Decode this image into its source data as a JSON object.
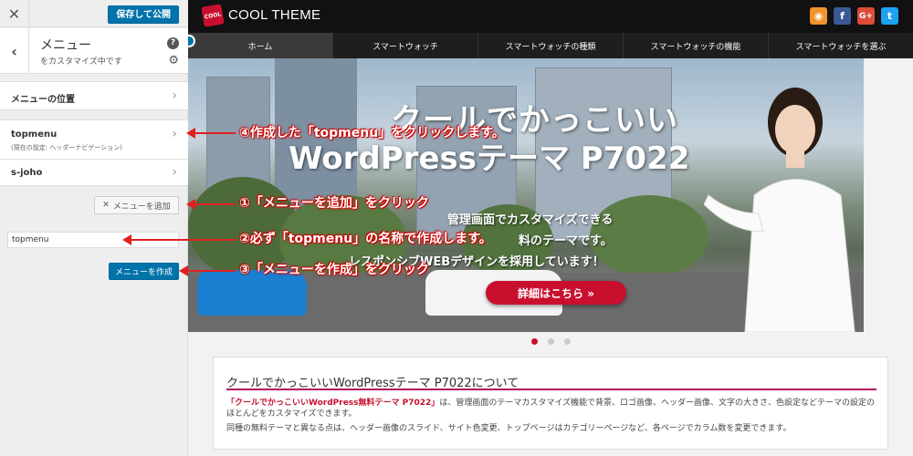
{
  "panel": {
    "close_icon": "close-icon",
    "save_label": "保存して公開",
    "title": "メニュー",
    "subtitle": "をカスタマイズ中です",
    "help_label": "?",
    "rows": [
      {
        "label": "メニューの位置",
        "sub": ""
      },
      {
        "label": "topmenu",
        "sub": "(現在の設定: ヘッダーナビゲーション)"
      },
      {
        "label": "s-joho",
        "sub": ""
      }
    ],
    "add_menu_label": "メニューを追加",
    "menu_name_value": "topmenu",
    "create_menu_label": "メニューを作成"
  },
  "site": {
    "logo_badge": "COOL",
    "logo_text": "COOL THEME",
    "social": [
      {
        "icon": "rss-icon",
        "glyph": "◉",
        "color": "#f0932b"
      },
      {
        "icon": "facebook-icon",
        "glyph": "f",
        "color": "#3b5998"
      },
      {
        "icon": "googleplus-icon",
        "glyph": "G+",
        "color": "#dd4b39"
      },
      {
        "icon": "twitter-icon",
        "glyph": "t",
        "color": "#1da1f2"
      }
    ],
    "nav": [
      "ホーム",
      "スマートウォッチ",
      "スマートウォッチの種類",
      "スマートウォッチの機能",
      "スマートウォッチを選ぶ"
    ],
    "hero": {
      "title1": "クールでかっこいい",
      "title2": "WordPressテーマ P7022",
      "line1": "管理画面でカスタマイズできる",
      "line2": "料のテーマです。",
      "line3": "レスポンシブWEBデザインを採用しています！",
      "cta": "詳細はこちら »"
    },
    "card": {
      "title": "クールでかっこいいWordPressテーマ P7022について",
      "para1_red": "「クールでかっこいいWordPress無料テーマ P7022」",
      "para1": "は、管理画面のテーマカスタマイズ機能で背景、ロゴ画像、ヘッダー画像、文字の大きさ、色設定などテーマの設定のほとんどをカスタマイズできます。",
      "para2": "同種の無料テーマと異なる点は、ヘッダー画像のスライド、サイト色変更、トップページはカテゴリーページなど、各ページでカラム数を変更できます。"
    }
  },
  "annotations": {
    "a4": "④作成した「topmenu」をクリックします。",
    "a1": "①「メニューを追加」をクリック",
    "a2": "②必ず「topmenu」の名称で作成します。",
    "a3": "③「メニューを作成」をクリック"
  }
}
